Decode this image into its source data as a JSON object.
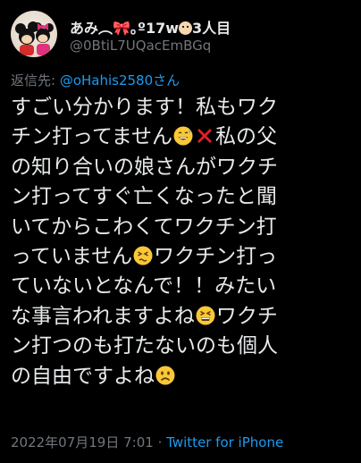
{
  "author": {
    "display_name_prefix": "あみ",
    "display_name_wave": "︵",
    "display_name_ribbon": "🎀",
    "display_name_suffix": "｡º17w",
    "display_name_tail": "3人目",
    "handle": "@0BtiL7UQacEmBGq",
    "avatar_icon": "mickey-minnie-icon"
  },
  "reply": {
    "prefix": "返信先: ",
    "mention": "@oHahis2580さん"
  },
  "tweet": {
    "lines": [
      {
        "text": "すごい分かります！私もワク"
      },
      {
        "text": "チン打ってません",
        "emoji_after": "sweat-smile-emoji",
        "text2": "",
        "emoji_after2": "cross-mark-emoji",
        "text3": "私の父"
      },
      {
        "text": "の知り合いの娘さんがワクチ"
      },
      {
        "text": "ン打ってすぐ亡くなったと聞"
      },
      {
        "text": "いてからこわくてワクチン打"
      },
      {
        "text": "っていません",
        "emoji_after": "persevering-face-emoji",
        "text2": "ワクチン打っ"
      },
      {
        "text": "ていないとなんで！！みたい"
      },
      {
        "text": "な事言われますよね",
        "emoji_after": "confounded-face-emoji",
        "text2": "ワクチ"
      },
      {
        "text": "ン打つのも打たないのも個人"
      },
      {
        "text": "の自由ですよね",
        "emoji_after": "frowning-face-emoji"
      }
    ]
  },
  "footer": {
    "timestamp": "2022年07月19日 7:01",
    "separator": " · ",
    "source": "Twitter for iPhone"
  },
  "colors": {
    "background": "#000000",
    "text": "#e7e9ea",
    "secondary": "#71767b",
    "link": "#1d9bf0",
    "emoji_yellow": "#f9c837",
    "cross_red": "#e0202b"
  }
}
